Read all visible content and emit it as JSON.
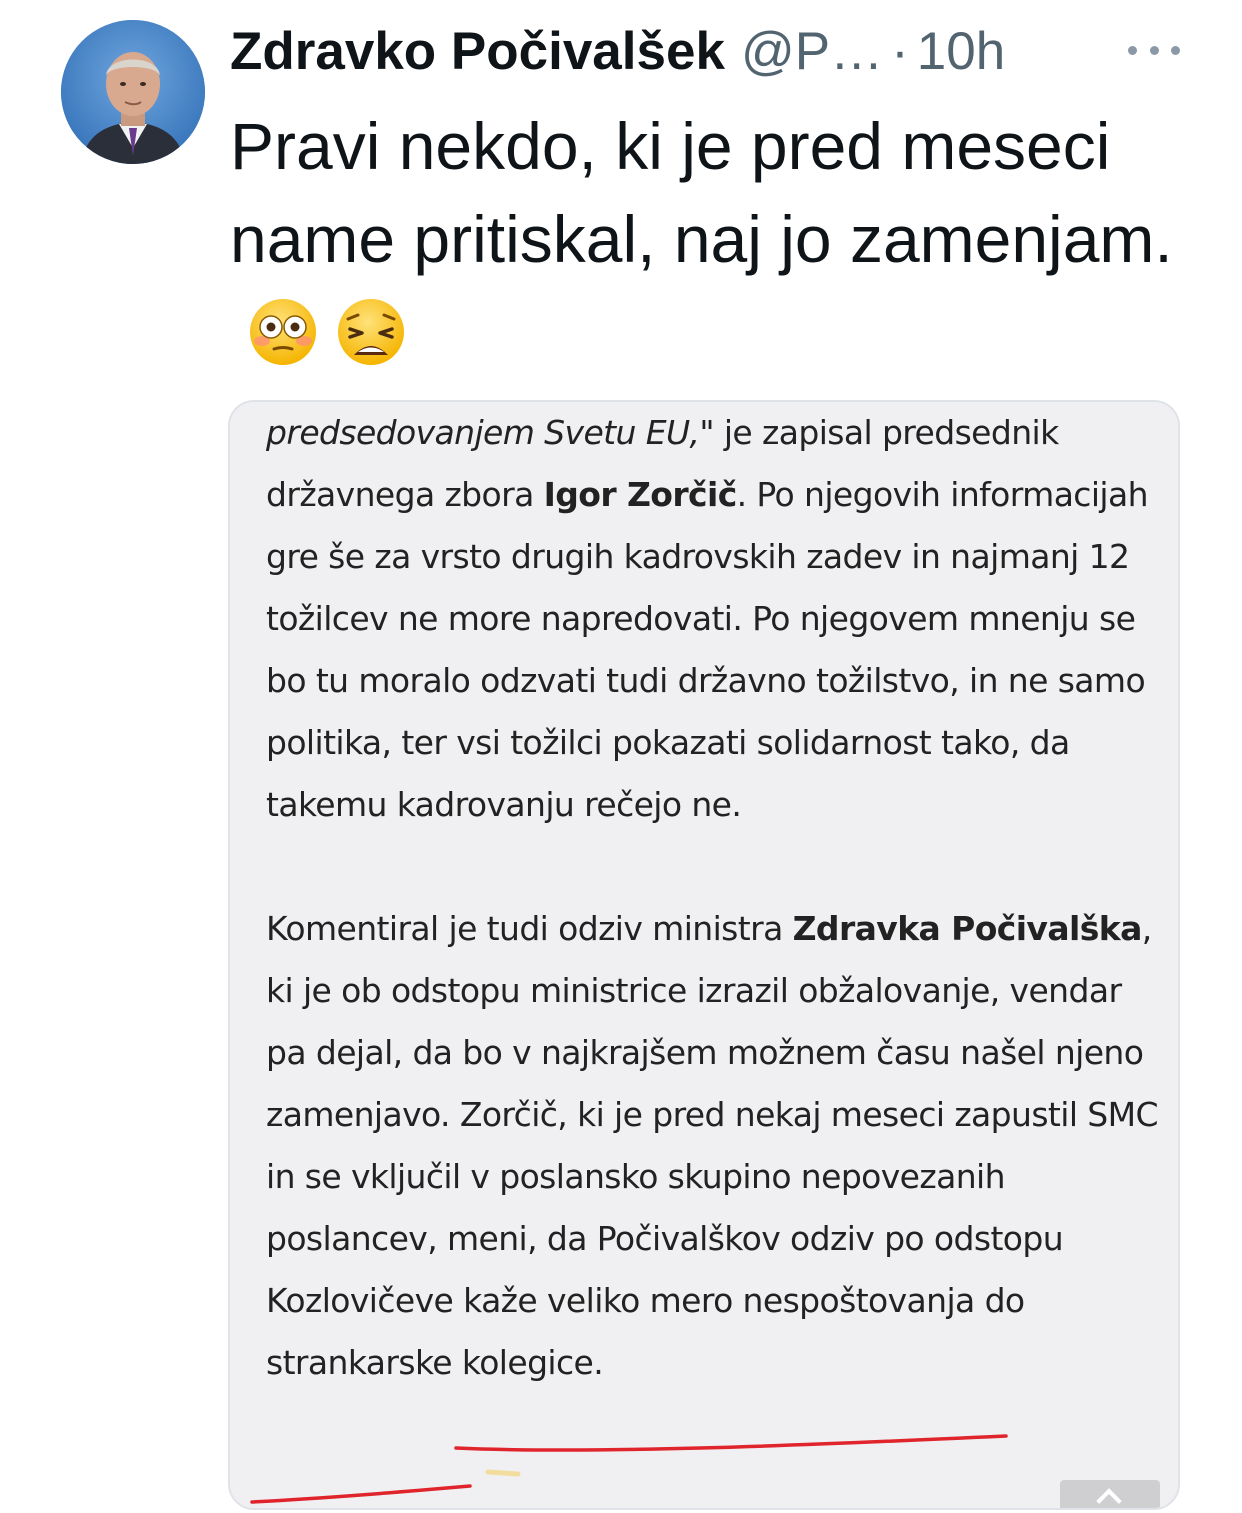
{
  "tweet": {
    "author_name": "Zdravko Počivalšek",
    "author_handle": "@P…",
    "separator": "·",
    "time": "10h",
    "text": "Pravi nekdo, ki je pred meseci name pritiskal, naj jo zamenjam.",
    "emojis": [
      "flushed-face-emoji",
      "weary-face-emoji"
    ]
  },
  "article": {
    "p1_italic": "predsedovanjem Svetu EU,\"",
    "p1_a": " je zapisal predsednik državnega zbora ",
    "p1_bold": "Igor Zorčič",
    "p1_b": ". Po njegovih informacijah gre še za vrsto drugih kadrovskih zadev in najmanj 12 tožilcev ne more napredovati. Po njegovem mnenju se bo tu moralo odzvati tudi državno tožilstvo, in ne samo politika, ter vsi tožilci pokazati solidarnost tako, da takemu kadrovanju rečejo ne.",
    "p2_a": "Komentiral je tudi odziv ministra ",
    "p2_bold": "Zdravka Počivalška",
    "p2_b": ", ki je ob odstopu ministrice izrazil obžalovanje, vendar pa dejal, da bo v najkrajšem možnem času našel njeno zamenjavo. Zorčič, ki je pred nekaj meseci zapustil SMC in se vključil v poslansko skupino nepovezanih poslancev, meni, da Počivalškov odziv po odstopu Kozlovičeve kaže veliko mero nespoštovanja do strankarske kolegice."
  },
  "colors": {
    "text": "#0f1419",
    "secondary": "#536471",
    "card_bg": "#f0f0f2",
    "underline": "#e0242c"
  }
}
